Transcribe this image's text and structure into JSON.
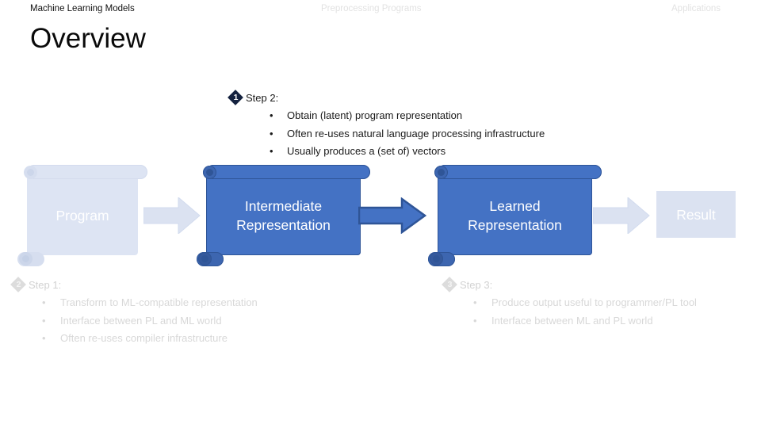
{
  "header": {
    "tabs": [
      {
        "label": "Machine Learning Models",
        "state": "active"
      },
      {
        "label": "Preprocessing Programs",
        "state": "muted"
      },
      {
        "label": "Applications",
        "state": "muted"
      }
    ]
  },
  "title": "Overview",
  "steps": {
    "step1": {
      "badge": "2",
      "title": "Step 1:",
      "bullet_glyph": "•",
      "bullets": [
        "Transform to ML-compatible representation",
        "Interface between PL and ML world",
        "Often re-uses compiler infrastructure"
      ],
      "state": "faded"
    },
    "step2": {
      "badge": "1",
      "title": "Step 2:",
      "bullet_glyph": "•",
      "bullets": [
        "Obtain (latent) program representation",
        "Often re-uses natural language processing infrastructure",
        "Usually produces a (set of) vectors"
      ],
      "state": "active"
    },
    "step3": {
      "badge": "3",
      "title": "Step 3:",
      "bullet_glyph": "•",
      "bullets": [
        "Produce output useful to programmer/PL tool",
        "Interface between ML and PL world"
      ],
      "state": "faded"
    }
  },
  "pipeline": {
    "nodes": [
      {
        "id": "program",
        "label_line1": "Program",
        "label_line2": "",
        "shape": "scroll",
        "state": "faded"
      },
      {
        "id": "ir",
        "label_line1": "Intermediate",
        "label_line2": "Representation",
        "shape": "scroll",
        "state": "active"
      },
      {
        "id": "learned",
        "label_line1": "Learned",
        "label_line2": "Representation",
        "shape": "scroll",
        "state": "active"
      },
      {
        "id": "result",
        "label_line1": "Result",
        "label_line2": "",
        "shape": "rect",
        "state": "faded"
      }
    ],
    "arrows": [
      {
        "id": "arrow-1",
        "state": "faded"
      },
      {
        "id": "arrow-2",
        "state": "active"
      },
      {
        "id": "arrow-3",
        "state": "faded"
      }
    ]
  },
  "colors": {
    "accent_blue": "#4472c4",
    "accent_blue_dark": "#2f5597",
    "faded_blue": "#dbe2f1",
    "faded_gray_text": "#d8d8d8",
    "badge_dark": "#15223f",
    "badge_faded": "#dcdcdc",
    "title_black": "#0a0a0a"
  }
}
